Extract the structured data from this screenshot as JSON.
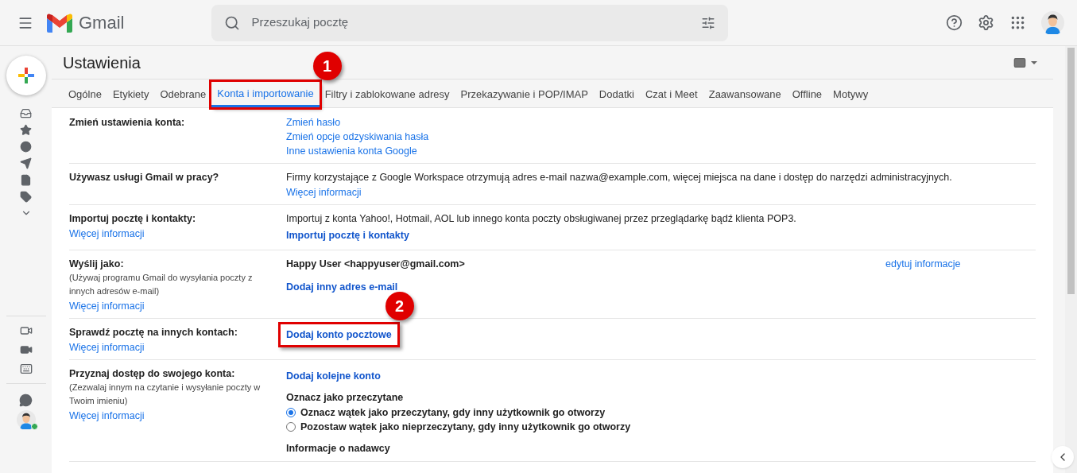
{
  "header": {
    "app_name": "Gmail",
    "search_placeholder": "Przeszukaj pocztę"
  },
  "settings_title": "Ustawienia",
  "tabs": [
    {
      "label": "Ogólne",
      "selected": false
    },
    {
      "label": "Etykiety",
      "selected": false
    },
    {
      "label": "Odebrane",
      "selected": false
    },
    {
      "label": "Konta i importowanie",
      "selected": true,
      "highlighted": true,
      "callout": "1"
    },
    {
      "label": "Filtry i zablokowane adresy",
      "selected": false
    },
    {
      "label": "Przekazywanie i POP/IMAP",
      "selected": false
    },
    {
      "label": "Dodatki",
      "selected": false
    },
    {
      "label": "Czat i Meet",
      "selected": false
    },
    {
      "label": "Zaawansowane",
      "selected": false
    },
    {
      "label": "Offline",
      "selected": false
    },
    {
      "label": "Motywy",
      "selected": false
    }
  ],
  "sections": [
    {
      "label": "Zmień ustawienia konta:",
      "items": [
        {
          "kind": "link",
          "text": "Zmień hasło"
        },
        {
          "kind": "link",
          "text": "Zmień opcje odzyskiwania hasła"
        },
        {
          "kind": "link",
          "text": "Inne ustawienia konta Google"
        }
      ]
    },
    {
      "label": "Używasz usługi Gmail w pracy?",
      "items": [
        {
          "kind": "text",
          "text": "Firmy korzystające z Google Workspace otrzymują adres e-mail nazwa@example.com, więcej miejsca na dane i dostęp do narzędzi administracyjnych."
        },
        {
          "kind": "link",
          "text": "Więcej informacji"
        }
      ]
    },
    {
      "label": "Importuj pocztę i kontakty:",
      "learn_more": "Więcej informacji",
      "items": [
        {
          "kind": "text",
          "text": "Importuj z konta Yahoo!, Hotmail, AOL lub innego konta poczty obsługiwanej przez przeglądarkę bądź klienta POP3."
        },
        {
          "kind": "action",
          "text": "Importuj pocztę i kontakty"
        }
      ]
    },
    {
      "label": "Wyślij jako:",
      "note": "(Używaj programu Gmail do wysyłania poczty z innych adresów e-mail)",
      "learn_more": "Więcej informacji",
      "items": [
        {
          "kind": "sender",
          "text": "Happy User <happyuser@gmail.com>",
          "edit": "edytuj informacje"
        },
        {
          "kind": "action",
          "text": "Dodaj inny adres e-mail"
        }
      ]
    },
    {
      "label": "Sprawdź pocztę na innych kontach:",
      "learn_more": "Więcej informacji",
      "items": [
        {
          "kind": "action",
          "text": "Dodaj konto pocztowe",
          "highlighted": true,
          "callout": "2"
        }
      ]
    },
    {
      "label": "Przyznaj dostęp do swojego konta:",
      "note": "(Zezwalaj innym na czytanie i wysyłanie poczty w Twoim imieniu)",
      "learn_more": "Więcej informacji",
      "items": [
        {
          "kind": "action",
          "text": "Dodaj kolejne konto"
        },
        {
          "kind": "heading",
          "text": "Oznacz jako przeczytane"
        },
        {
          "kind": "radio",
          "text": "Oznacz wątek jako przeczytany, gdy inny użytkownik go otworzy",
          "selected": true
        },
        {
          "kind": "radio",
          "text": "Pozostaw wątek jako nieprzeczytany, gdy inny użytkownik go otworzy",
          "selected": false
        },
        {
          "kind": "heading",
          "text": "Informacje o nadawcy"
        }
      ]
    }
  ]
}
